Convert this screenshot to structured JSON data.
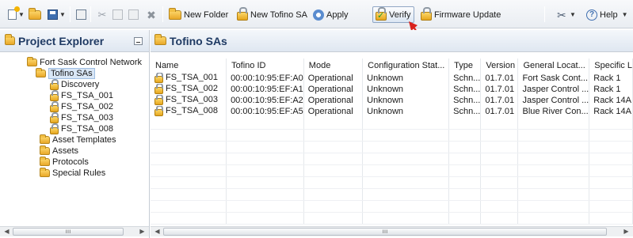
{
  "toolbar": {
    "new_folder": "New Folder",
    "new_tofino_sa": "New Tofino SA",
    "apply": "Apply",
    "verify": "Verify",
    "firmware_update": "Firmware Update",
    "help": "Help"
  },
  "left": {
    "title": "Project Explorer",
    "tree": [
      {
        "label": "Fort Sask Control Network",
        "icon": "network-folder-icon"
      },
      {
        "label": "Tofino SAs",
        "icon": "folder-icon"
      },
      {
        "label": "Discovery",
        "icon": "discovery-icon"
      },
      {
        "label": "FS_TSA_001",
        "icon": "lock-icon"
      },
      {
        "label": "FS_TSA_002",
        "icon": "lock-icon"
      },
      {
        "label": "FS_TSA_003",
        "icon": "lock-icon"
      },
      {
        "label": "FS_TSA_008",
        "icon": "lock-icon"
      },
      {
        "label": "Asset Templates",
        "icon": "folder-icon"
      },
      {
        "label": "Assets",
        "icon": "folder-icon"
      },
      {
        "label": "Protocols",
        "icon": "folder-icon"
      },
      {
        "label": "Special Rules",
        "icon": "folder-icon"
      }
    ]
  },
  "right": {
    "title": "Tofino SAs",
    "columns": [
      "Name",
      "Tofino ID",
      "Mode",
      "Configuration Stat...",
      "Type",
      "Version",
      "General Locat...",
      "Specific L"
    ],
    "rows": [
      [
        "FS_TSA_001",
        "00:00:10:95:EF:A0",
        "Operational",
        "Unknown",
        "Schn...",
        "01.7.01",
        "Fort Sask Cont...",
        "Rack 1"
      ],
      [
        "FS_TSA_002",
        "00:00:10:95:EF:A1",
        "Operational",
        "Unknown",
        "Schn...",
        "01.7.01",
        "Jasper Control ...",
        "Rack 1"
      ],
      [
        "FS_TSA_003",
        "00:00:10:95:EF:A2",
        "Operational",
        "Unknown",
        "Schn...",
        "01.7.01",
        "Jasper Control ...",
        "Rack 14A"
      ],
      [
        "FS_TSA_008",
        "00:00:10:95:EF:A5",
        "Operational",
        "Unknown",
        "Schn...",
        "01.7.01",
        "Blue River Con...",
        "Rack 14A"
      ]
    ]
  }
}
